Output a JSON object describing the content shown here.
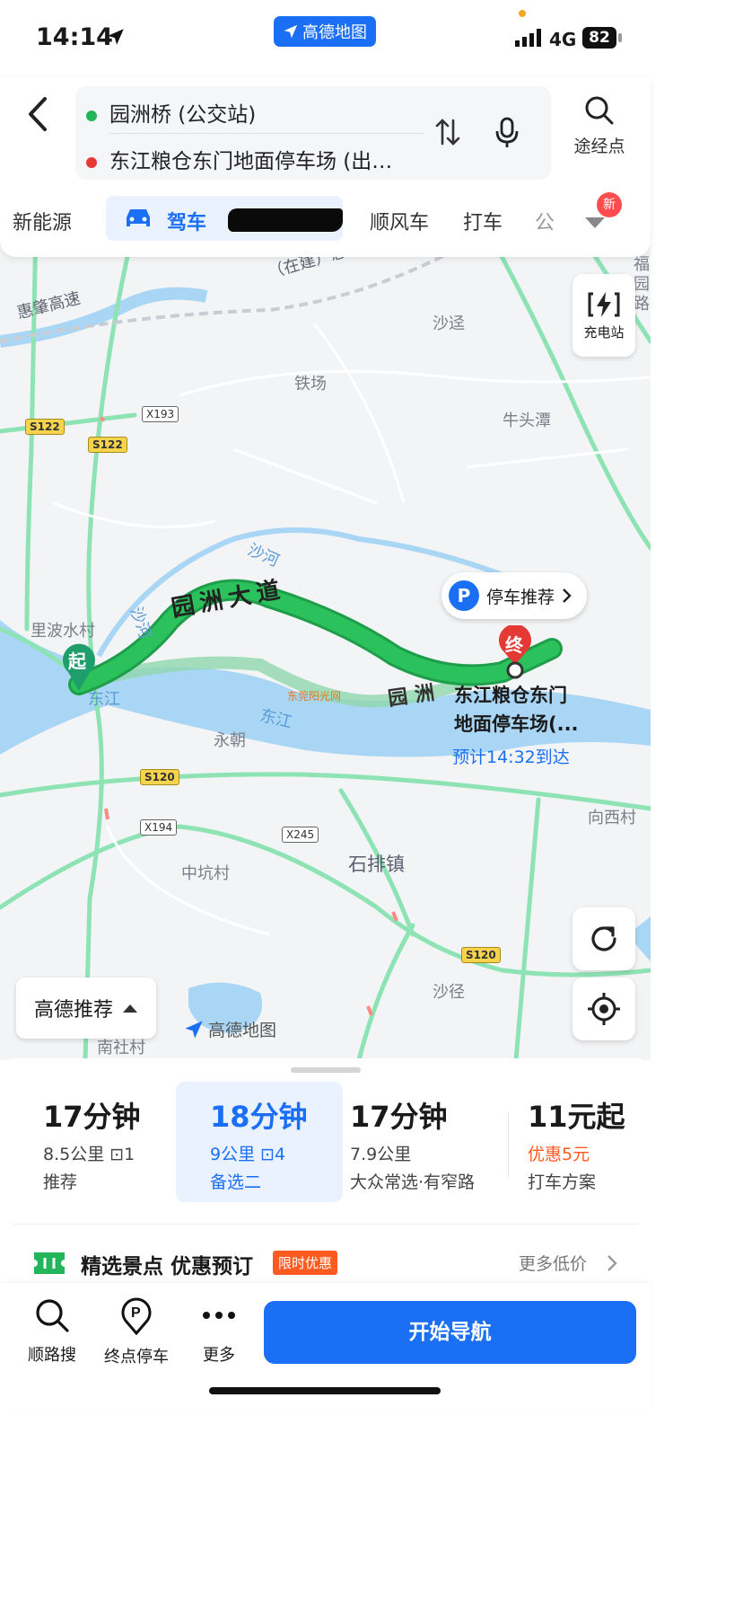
{
  "status": {
    "time": "14:14",
    "brand": "高德地图",
    "network": "4G",
    "battery": "82"
  },
  "route": {
    "origin": "园洲桥 (公交站)",
    "destination": "东江粮仓东门地面停车场 (出…",
    "waypoint_label": "途经点"
  },
  "modes": [
    {
      "label": "新能源"
    },
    {
      "label": "驾车"
    },
    {
      "label": "顺风车"
    },
    {
      "label": "打车"
    },
    {
      "label": "公"
    }
  ],
  "new_badge": "新",
  "map": {
    "charge_label": "充电站",
    "parking_label": "停车推荐",
    "parking_icon": "P",
    "start_marker": "起",
    "end_marker": "终",
    "destination_line1": "东江粮仓东门",
    "destination_line2": "地面停车场(...",
    "eta": "预计14:32到达",
    "recommend_label": "高德推荐",
    "logo_text": "高德地图",
    "road_labels": {
      "expressway": "惠肇高速",
      "expressway_construction": "（在建）惠肇高速",
      "avenue": "园洲大道",
      "avenue2": "园洲"
    },
    "places": [
      "沙迳",
      "铁场",
      "牛头潭",
      "里波水村",
      "永朝",
      "中坑村",
      "石排镇",
      "沙径",
      "向西村",
      "南社村",
      "福园路"
    ],
    "rivers": [
      "沙河",
      "东江",
      "东江",
      "沙河"
    ],
    "shields": [
      "S122",
      "S122",
      "X193",
      "S120",
      "X194",
      "X245",
      "S120"
    ],
    "watermark": "东莞阳光网"
  },
  "options": [
    {
      "time": "17分钟",
      "detail": "8.5公里  ⊡1",
      "sub": "推荐",
      "selected": false
    },
    {
      "time": "18分钟",
      "detail": "9公里  ⊡4",
      "sub": "备选二",
      "selected": true
    },
    {
      "time": "17分钟",
      "detail": "7.9公里",
      "sub": "大众常选·有窄路",
      "selected": false
    },
    {
      "time": "11元起",
      "detail": "优惠5元",
      "sub": "打车方案",
      "selected": false
    }
  ],
  "promo": {
    "title": "精选景点 优惠预订",
    "tag": "限时优惠",
    "more": "更多低价"
  },
  "bottom": {
    "search_along": "顺路搜",
    "end_parking": "终点停车",
    "more": "更多",
    "start_nav": "开始导航"
  },
  "colors": {
    "accent": "#1a6ff5",
    "route": "#22b55a",
    "alt_route": "#8fd7ae",
    "water": "#a9d6f5",
    "road": "#8ee3b4"
  }
}
